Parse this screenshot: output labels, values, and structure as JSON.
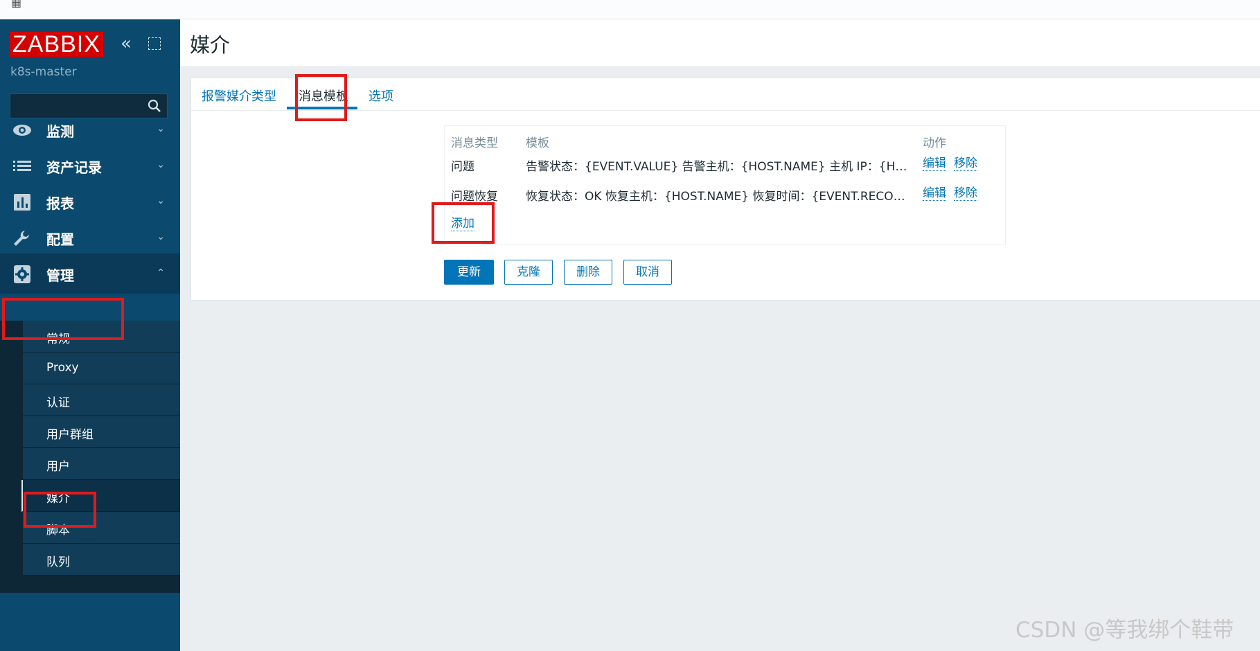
{
  "sidebar": {
    "logo": "ZABBIX",
    "collapse_glyph": "«",
    "hostname": "k8s-master",
    "search_value": "",
    "menu": [
      {
        "label": "监测",
        "icon": "eye-icon",
        "chevron": "⌄"
      },
      {
        "label": "资产记录",
        "icon": "list-icon",
        "chevron": "⌄"
      },
      {
        "label": "报表",
        "icon": "bar-chart-icon",
        "chevron": "⌄"
      },
      {
        "label": "配置",
        "icon": "wrench-icon",
        "chevron": "⌄"
      },
      {
        "label": "管理",
        "icon": "gear-icon",
        "chevron": "⌃"
      }
    ],
    "submenu": [
      "常规",
      "Proxy",
      "认证",
      "用户群组",
      "用户",
      "媒介",
      "脚本",
      "队列"
    ]
  },
  "page": {
    "title": "媒介",
    "tabs": [
      "报警媒介类型",
      "消息模板",
      "选项"
    ],
    "table": {
      "headers": [
        "消息类型",
        "模板",
        "动作"
      ],
      "rows": [
        {
          "type": "问题",
          "template": "告警状态：{EVENT.VALUE} 告警主机：{HOST.NAME} 主机 IP：{H…",
          "edit": "编辑",
          "remove": "移除"
        },
        {
          "type": "问题恢复",
          "template": "恢复状态：OK 恢复主机：{HOST.NAME} 恢复时间：{EVENT.RECO…",
          "edit": "编辑",
          "remove": "移除"
        }
      ],
      "add": "添加"
    },
    "buttons": {
      "update": "更新",
      "clone": "克隆",
      "delete": "删除",
      "cancel": "取消"
    }
  },
  "watermark": "CSDN @等我绑个鞋带",
  "colors": {
    "sidebar": "#0b4a6e",
    "accent": "#0275b8",
    "logo": "#d40000",
    "annotation": "#e01b1b"
  }
}
